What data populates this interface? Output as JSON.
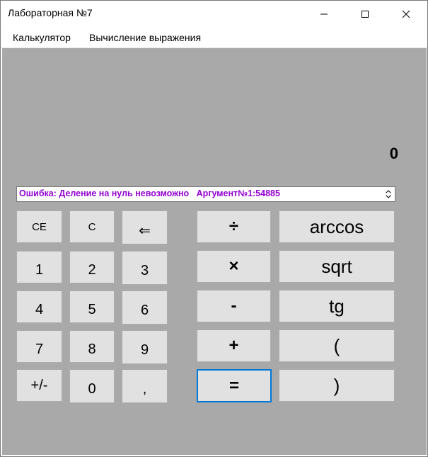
{
  "window": {
    "title": "Лабораторная №7"
  },
  "menu": {
    "items": [
      "Калькулятор",
      "Вычисление выражения"
    ]
  },
  "display": {
    "value": "0"
  },
  "history": {
    "text": "Ошибка: Деление на нуль невозможно   Аргумент№1:54885"
  },
  "keys": {
    "ce": "CE",
    "c": "C",
    "back": "⇐",
    "d1": "1",
    "d2": "2",
    "d3": "3",
    "d4": "4",
    "d5": "5",
    "d6": "6",
    "d7": "7",
    "d8": "8",
    "d9": "9",
    "sign": "+/-",
    "d0": "0",
    "comma": ",",
    "div": "÷",
    "mul": "×",
    "sub": "-",
    "add": "+",
    "eq": "=",
    "arccos": "arccos",
    "sqrt": "sqrt",
    "tg": "tg",
    "lparen": "(",
    "rparen": ")"
  },
  "colors": {
    "client_bg": "#a9a9a9",
    "button_bg": "#e1e1e1",
    "history_text": "#9400d3",
    "focus_border": "#0078d7"
  }
}
